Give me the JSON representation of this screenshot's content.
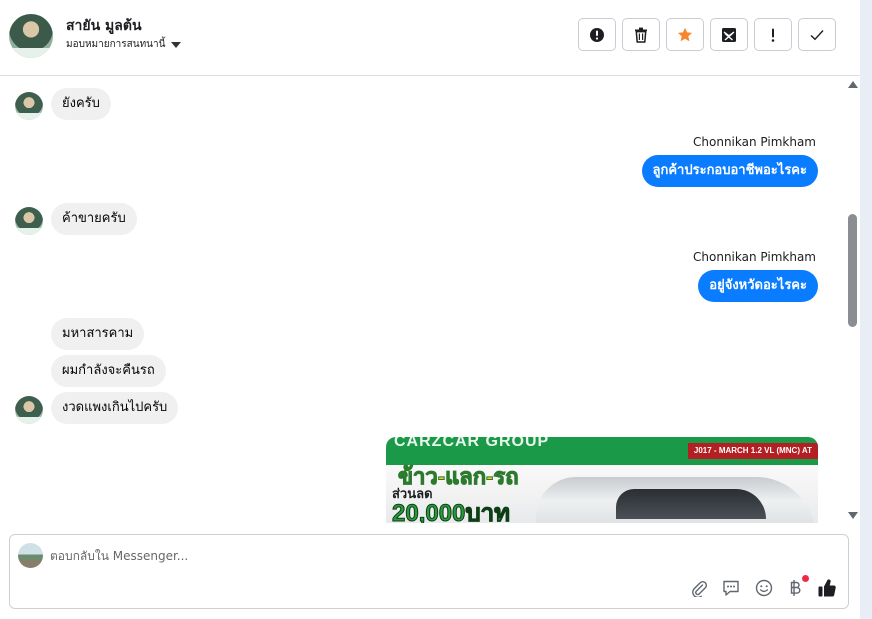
{
  "header": {
    "contact_name": "สายัน มูลต้น",
    "assign_label": "มอบหมายการสนทนานี้",
    "actions": [
      {
        "name": "report-button",
        "icon": "exclamation-circle-icon"
      },
      {
        "name": "delete-button",
        "icon": "trash-icon"
      },
      {
        "name": "star-button",
        "icon": "star-icon",
        "color": "#f5862a"
      },
      {
        "name": "spam-button",
        "icon": "envelope-x-icon"
      },
      {
        "name": "important-button",
        "icon": "exclamation-icon"
      },
      {
        "name": "done-button",
        "icon": "check-icon"
      }
    ]
  },
  "messages": [
    {
      "side": "in",
      "text": "ยังครับ"
    },
    {
      "side": "out",
      "sender": "Chonnikan Pimkham",
      "text": "ลูกค้าประกอบอาชีพอะไรคะ"
    },
    {
      "side": "in",
      "text": "ค้าขายครับ"
    },
    {
      "side": "out",
      "sender": "Chonnikan Pimkham",
      "text": "อยู่จังหวัดอะไรคะ"
    },
    {
      "side": "in",
      "text": "มหาสารคาม"
    },
    {
      "side": "in",
      "text": "ผมกำลังจะคืนรถ"
    },
    {
      "side": "in",
      "text": "งวดแพงเกินไปครับ"
    }
  ],
  "promo": {
    "banner": "CARZCAR GROUP",
    "spec": "J017 - MARCH 1.2 VL (MNC) AT",
    "headline": "ข้าว-แลก-รถ",
    "sub": "ส่วนลด",
    "amount": "20,000บาท"
  },
  "composer": {
    "placeholder": "ตอบกลับใน Messenger...",
    "tools": [
      "paperclip-icon",
      "chat-bubble-icon",
      "smiley-icon",
      "baht-icon",
      "thumbs-up-icon"
    ]
  },
  "colors": {
    "outgoing_bubble": "#0a7cff",
    "incoming_bubble": "#f0f0f0",
    "star": "#f5862a",
    "notification_dot": "#f02849"
  }
}
